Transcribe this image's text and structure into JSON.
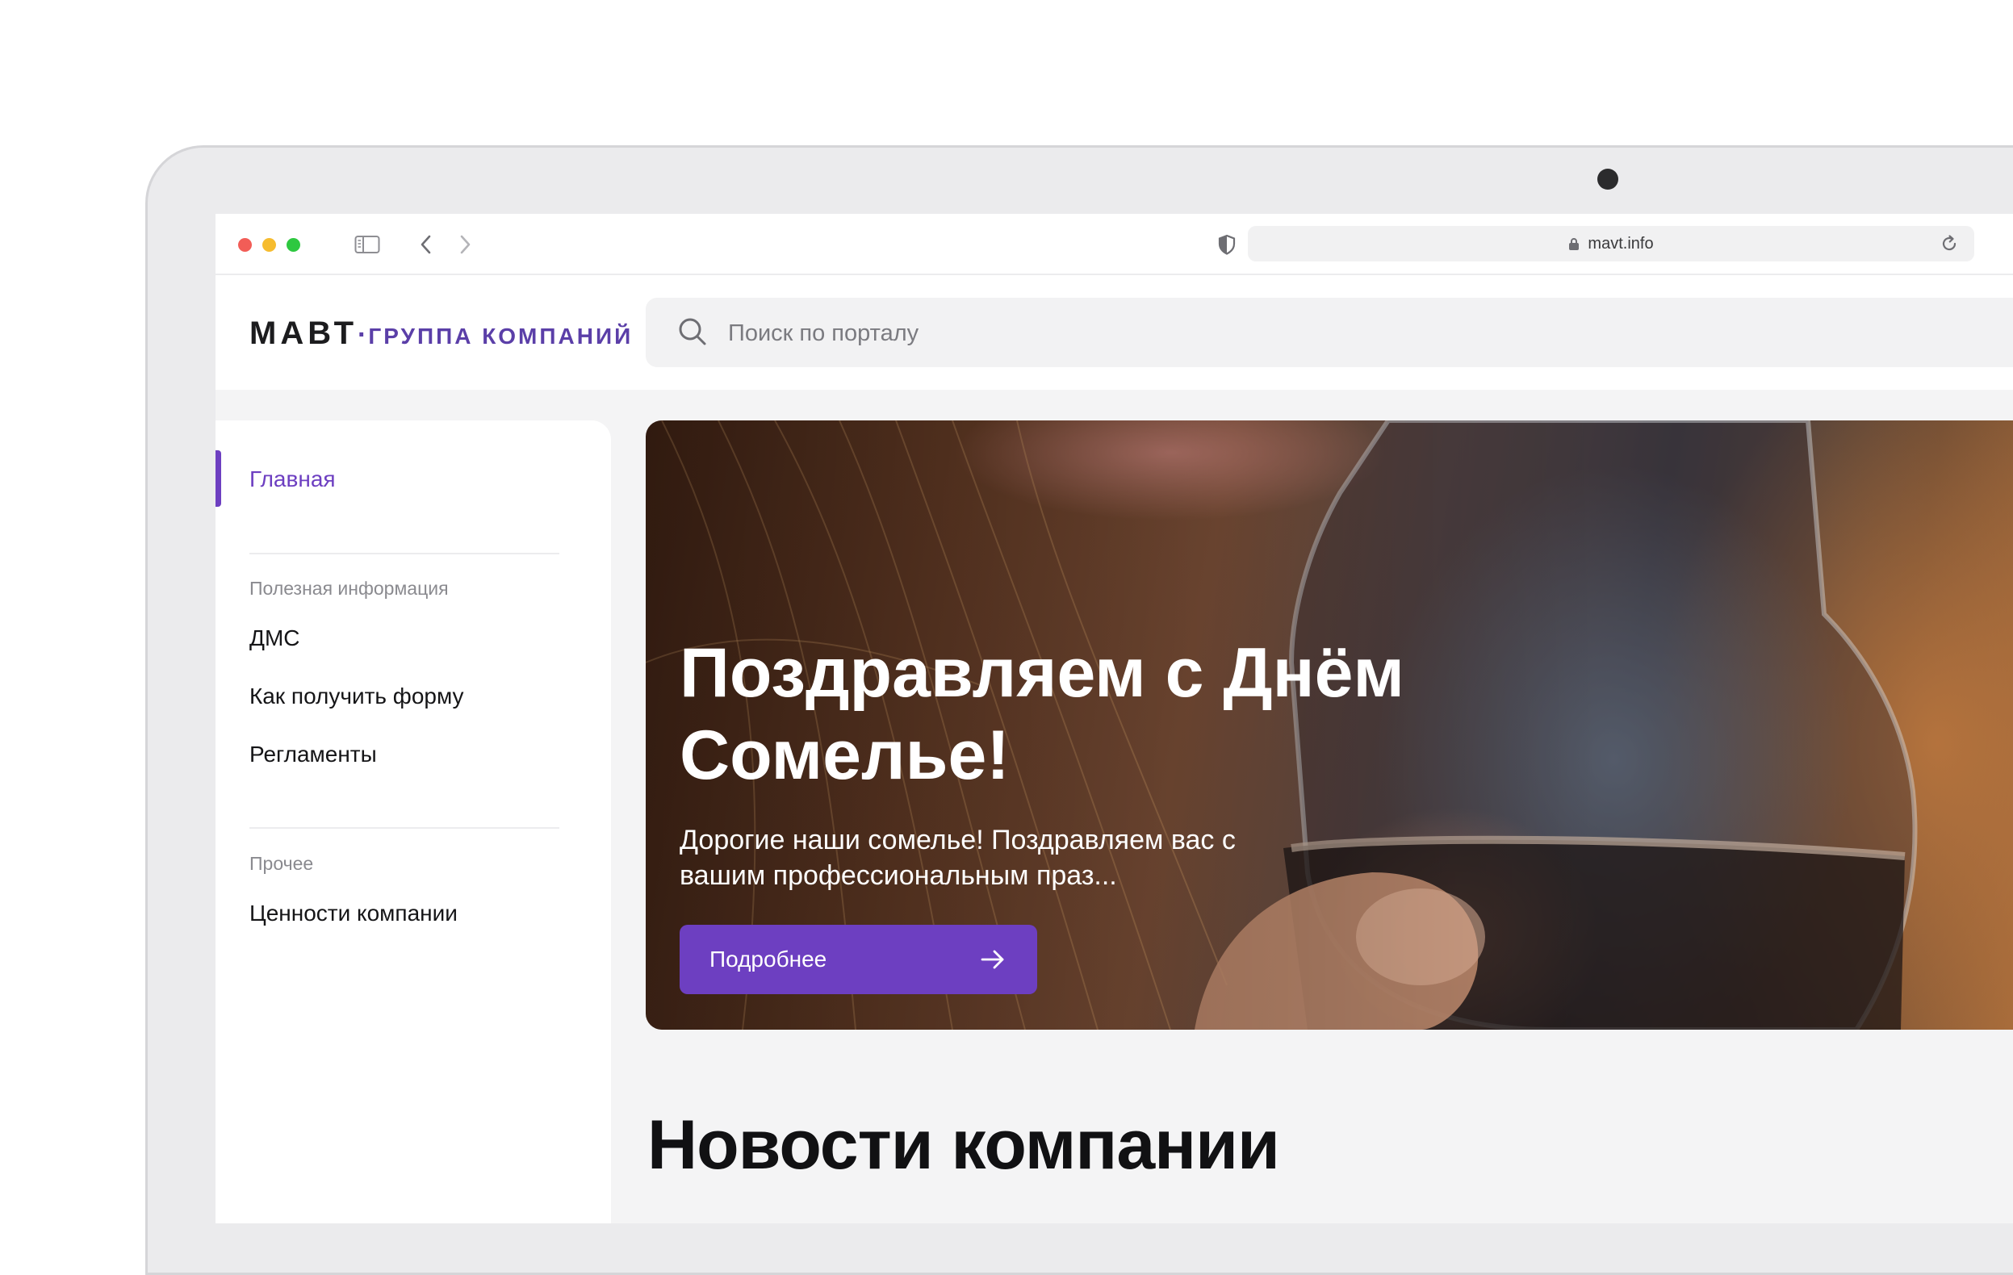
{
  "browser": {
    "url": "mavt.info"
  },
  "header": {
    "logo_main": "МАВТ",
    "logo_separator": "·",
    "logo_sub": "ГРУППА КОМПАНИЙ",
    "search_placeholder": "Поиск по порталу"
  },
  "sidebar": {
    "home_label": "Главная",
    "sections": [
      {
        "caption": "Полезная информация",
        "items": [
          "ДМС",
          "Как получить форму",
          "Регламенты"
        ]
      },
      {
        "caption": "Прочее",
        "items": [
          "Ценности компании"
        ]
      }
    ]
  },
  "hero": {
    "title": "Поздравляем с Днём Сомелье!",
    "text": "Дорогие наши сомелье! Поздравляем вас с вашим профессиональным праз...",
    "button_label": "Подробнее"
  },
  "news": {
    "title": "Новости компании"
  },
  "colors": {
    "accent": "#6d3fc1",
    "logo_accent": "#5b3fa8",
    "page_background": "#f4f4f5"
  }
}
